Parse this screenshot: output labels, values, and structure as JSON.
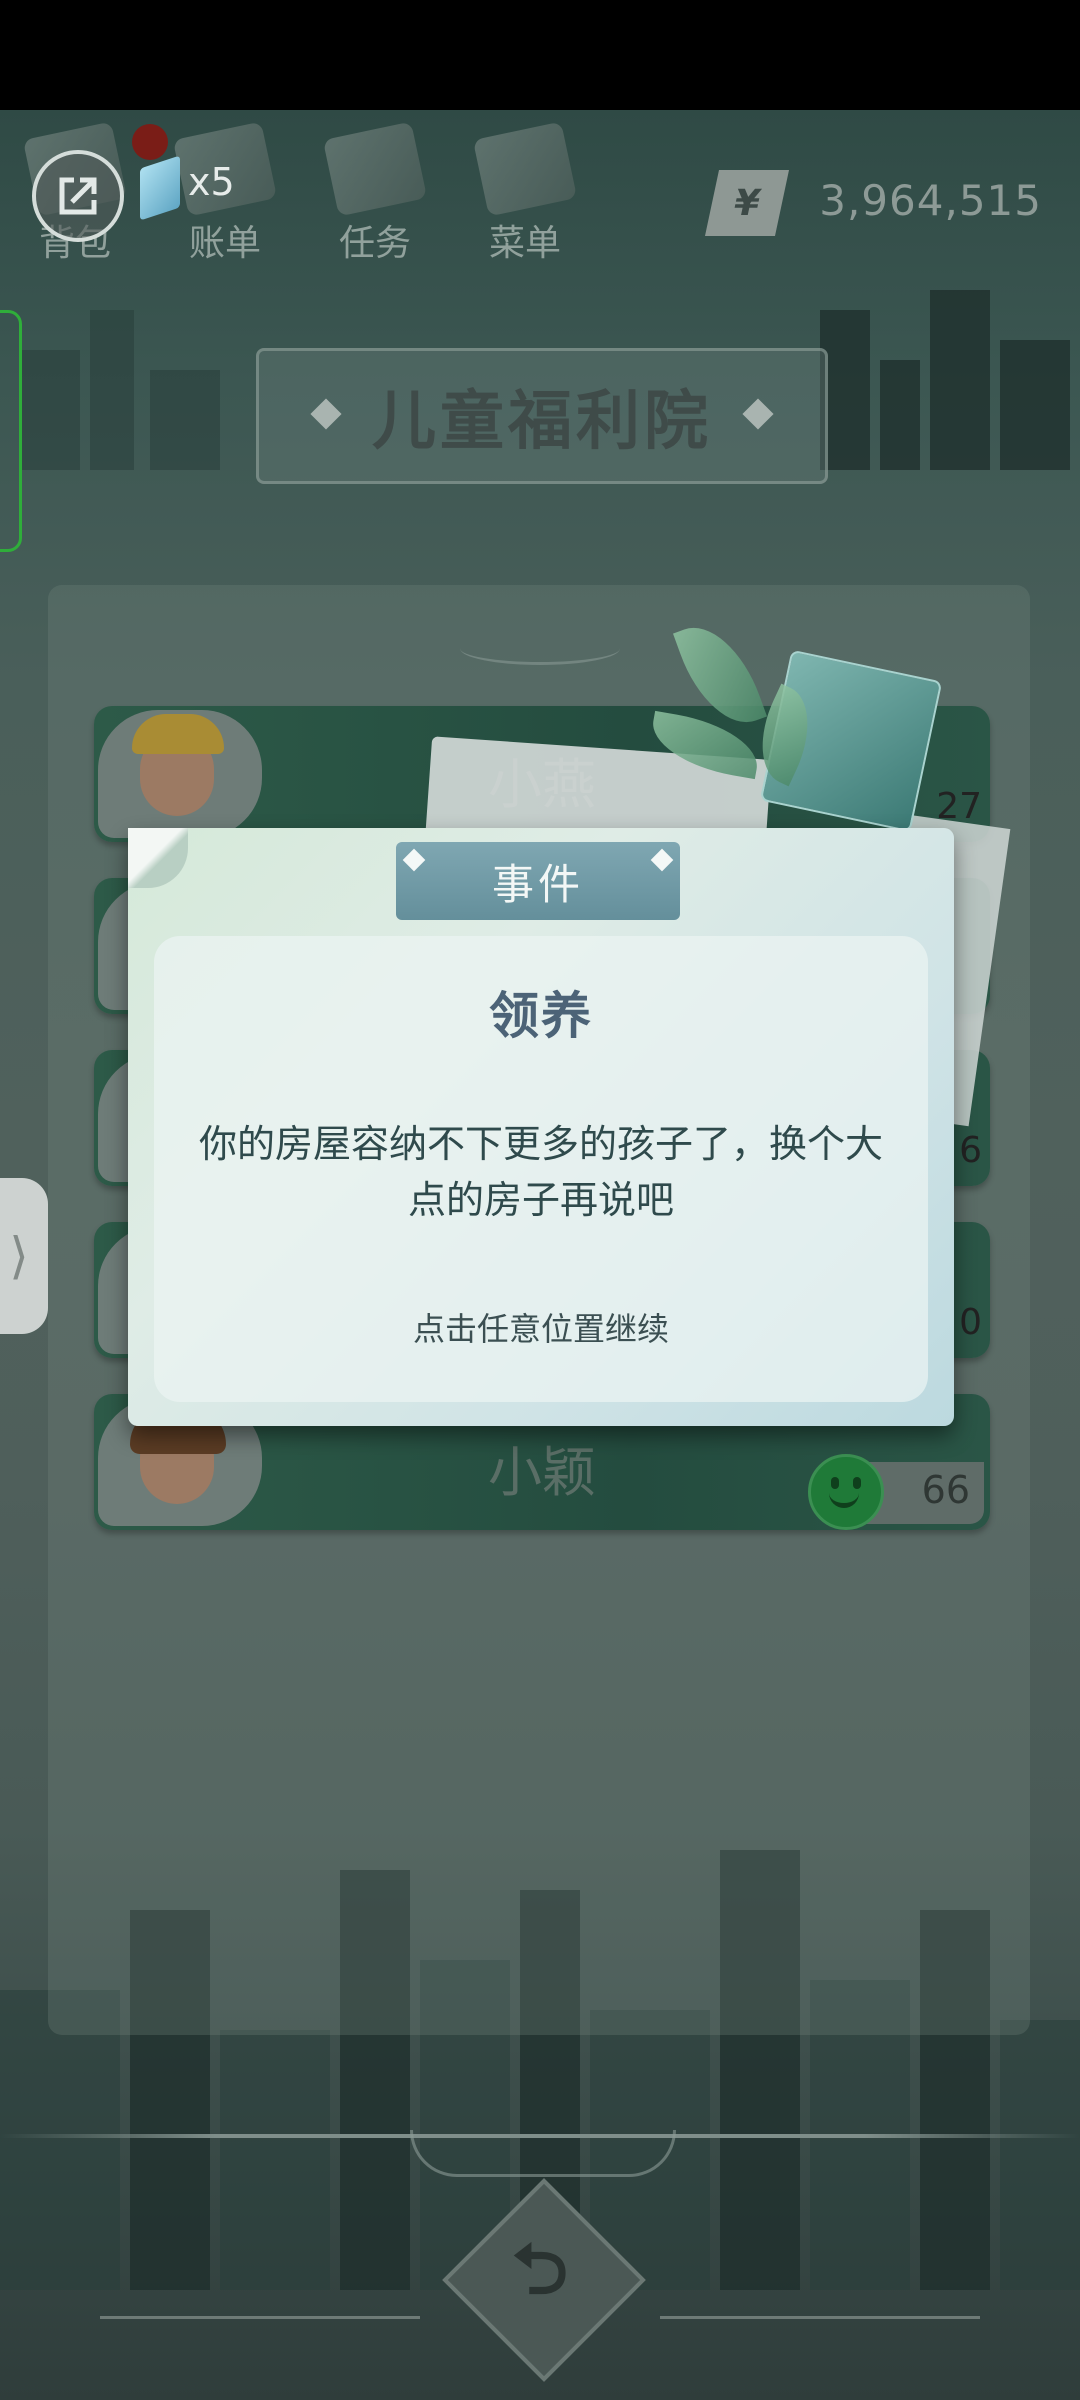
{
  "topbar": {
    "nav": [
      {
        "label": "背包",
        "icon": "backpack-icon"
      },
      {
        "label": "账单",
        "icon": "bill-icon"
      },
      {
        "label": "任务",
        "icon": "task-icon"
      },
      {
        "label": "菜单",
        "icon": "menu-icon"
      }
    ],
    "ticket_count": "x5",
    "currency_symbol": "¥",
    "money": "3,964,515"
  },
  "page": {
    "title": "儿童福利院"
  },
  "children": [
    {
      "name": "小燕",
      "score": "27"
    },
    {
      "name": "",
      "score": ""
    },
    {
      "name": "",
      "score": "6"
    },
    {
      "name": "",
      "score": "0"
    },
    {
      "name": "小颖",
      "score": "66"
    }
  ],
  "modal": {
    "tag": "事件",
    "title": "领养",
    "message": "你的房屋容纳不下更多的孩子了，换个大点的房子再说吧",
    "hint": "点击任意位置继续"
  },
  "side_handle": "⟩",
  "colors": {
    "accent_green": "#2fae3a",
    "modal_title": "#4c6377"
  }
}
